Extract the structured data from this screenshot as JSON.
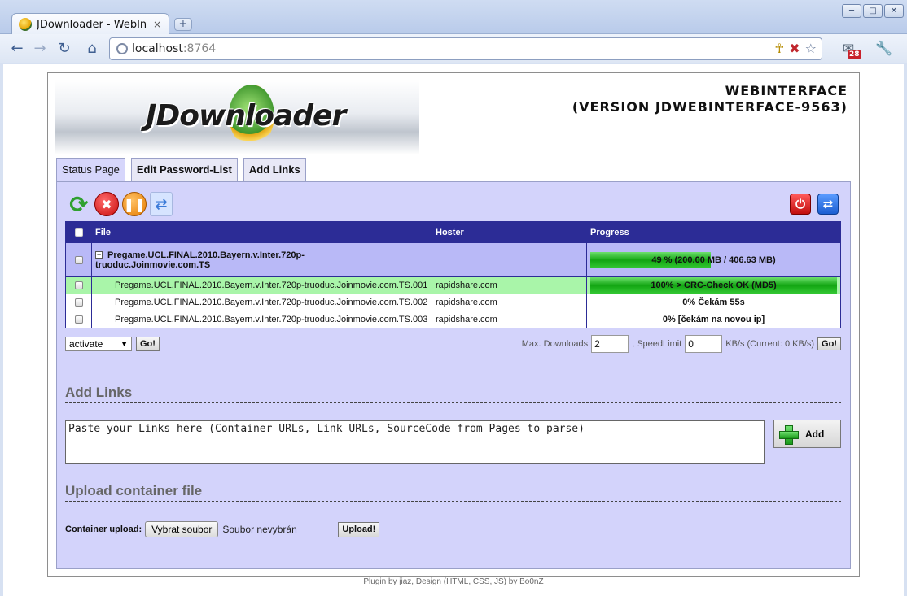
{
  "browser": {
    "tab_title": "JDownloader - WebInt...",
    "tab_close": "×",
    "new_tab": "+",
    "url_host": "localhost",
    "url_port": ":8764",
    "mail_badge": "28"
  },
  "header": {
    "logo_text": "JDownloader",
    "title_line1": "WEBINTERFACE",
    "title_line2": "(VERSION JDWEBINTERFACE-9563)"
  },
  "tabs": [
    {
      "label": "Status Page"
    },
    {
      "label": "Edit Password-List"
    },
    {
      "label": "Add Links"
    }
  ],
  "table": {
    "columns": [
      "File",
      "Hoster",
      "Progress"
    ],
    "package": {
      "toggle": "−",
      "name_line1": "Pregame.UCL.FINAL.2010.Bayern.v.Inter.720p-",
      "name_line2": "truoduc.Joinmovie.com.TS",
      "hoster": "",
      "progress_fraction": 0.49,
      "progress_label": "49 % (200.00 MB / 406.63 MB)"
    },
    "files": [
      {
        "name": "Pregame.UCL.FINAL.2010.Bayern.v.Inter.720p-truoduc.Joinmovie.com.TS.001",
        "hoster": "rapidshare.com",
        "progress_fraction": 1.0,
        "progress_label": "100% > CRC-Check OK (MD5)"
      },
      {
        "name": "Pregame.UCL.FINAL.2010.Bayern.v.Inter.720p-truoduc.Joinmovie.com.TS.002",
        "hoster": "rapidshare.com",
        "progress_fraction": 0,
        "progress_label": "0% Čekám 55s"
      },
      {
        "name": "Pregame.UCL.FINAL.2010.Bayern.v.Inter.720p-truoduc.Joinmovie.com.TS.003",
        "hoster": "rapidshare.com",
        "progress_fraction": 0,
        "progress_label": "0% [čekám na novou ip]"
      }
    ]
  },
  "controls": {
    "action_select": "activate",
    "go_label": "Go!",
    "max_downloads_label": "Max. Downloads",
    "max_downloads_value": "2",
    "speed_label": ", SpeedLimit",
    "speed_value": "0",
    "speed_unit": "KB/s (Current: 0 KB/s)"
  },
  "add_links": {
    "heading": "Add Links",
    "placeholder": "Paste your Links here (Container URLs, Link URLs, SourceCode from Pages to parse)",
    "add_label": "Add"
  },
  "upload": {
    "heading": "Upload container file",
    "label": "Container upload:",
    "choose_label": "Vybrat soubor",
    "status": "Soubor nevybrán",
    "upload_label": "Upload!"
  },
  "footer": "Plugin by jiaz, Design (HTML, CSS, JS) by Bo0nZ",
  "colors": {
    "panel_bg": "#d3d3fb",
    "header_bg": "#2c2c96",
    "done_row": "#a9f5a9",
    "progress_green": "#12a512"
  }
}
